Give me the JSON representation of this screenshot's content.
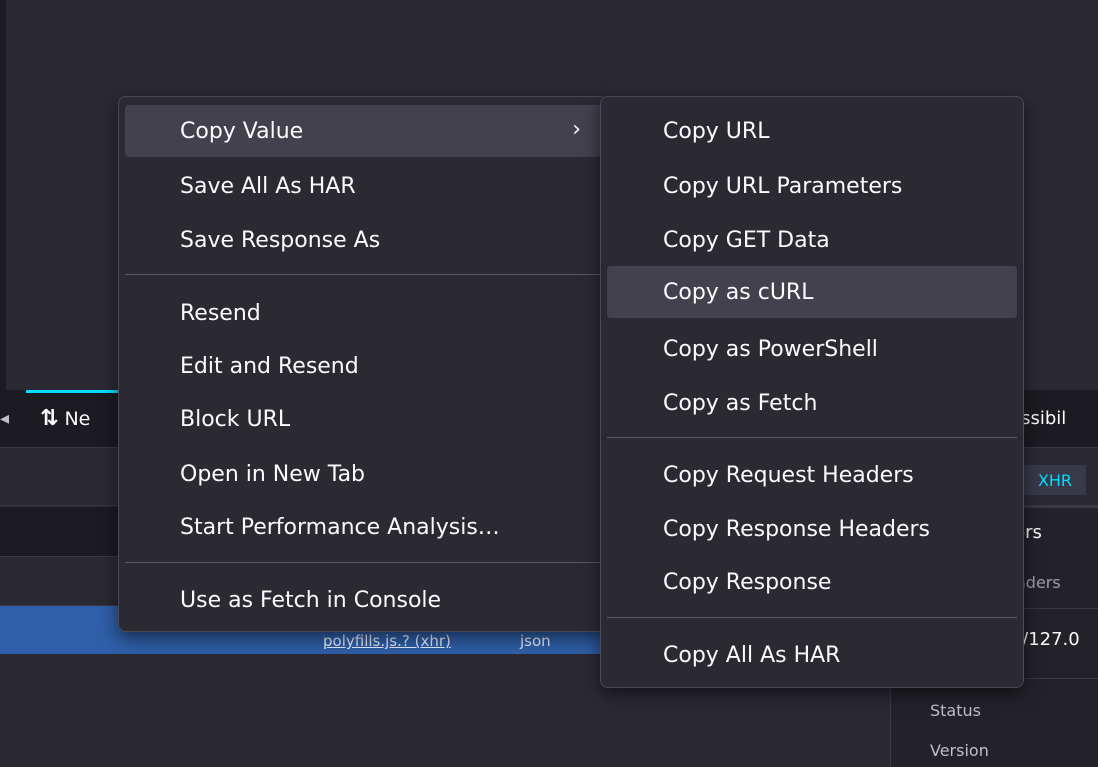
{
  "devtools": {
    "network_tab": "Ne",
    "accessibility_tab": "essibil",
    "xhr_filter": "XHR",
    "side_panel": {
      "tab": "ers",
      "headers_label": "aders",
      "url_fragment": "://127.0",
      "status_label": "Status",
      "version_label": "Version"
    },
    "request_row": {
      "file": "polyfills.js.? (xhr)",
      "type": "json"
    }
  },
  "context_menu": {
    "copy_value": "Copy Value",
    "copy_value_chevron": "›",
    "save_all_as_har": "Save All As HAR",
    "save_response_as": "Save Response As",
    "resend": "Resend",
    "edit_and_resend": "Edit and Resend",
    "block_url": "Block URL",
    "open_in_new_tab": "Open in New Tab",
    "start_performance_analysis": "Start Performance Analysis…",
    "use_as_fetch_in_console": "Use as Fetch in Console"
  },
  "copy_submenu": {
    "copy_url": "Copy URL",
    "copy_url_parameters": "Copy URL Parameters",
    "copy_get_data": "Copy GET Data",
    "copy_as_curl": "Copy as cURL",
    "copy_as_powershell": "Copy as PowerShell",
    "copy_as_fetch": "Copy as Fetch",
    "copy_request_headers": "Copy Request Headers",
    "copy_response_headers": "Copy Response Headers",
    "copy_response": "Copy Response",
    "copy_all_as_har": "Copy All As HAR"
  }
}
